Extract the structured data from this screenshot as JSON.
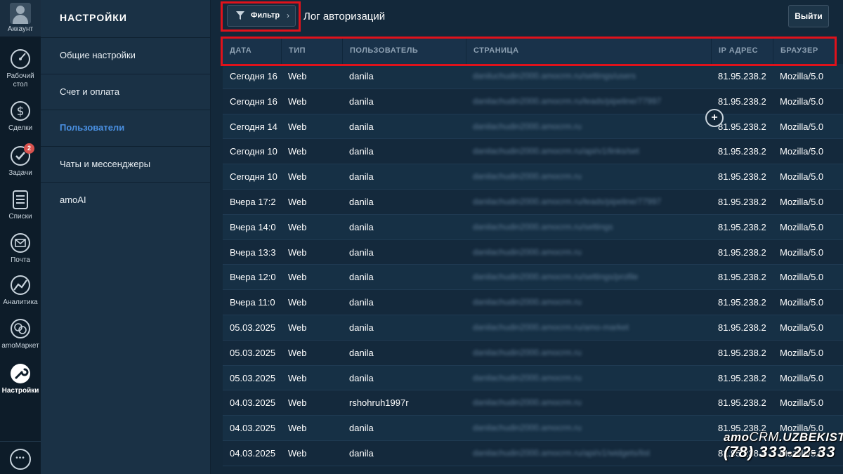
{
  "rail": {
    "account": "Аккаунт",
    "items": [
      {
        "label": "Рабочий стол",
        "icon": "dashboard-icon"
      },
      {
        "label": "Сделки",
        "icon": "dollar-icon"
      },
      {
        "label": "Задачи",
        "icon": "check-icon",
        "badge": "2"
      },
      {
        "label": "Списки",
        "icon": "list-icon"
      },
      {
        "label": "Почта",
        "icon": "mail-icon"
      },
      {
        "label": "Аналитика",
        "icon": "analytics-icon"
      },
      {
        "label": "amoМаркет",
        "icon": "market-icon"
      },
      {
        "label": "Настройки",
        "icon": "settings-icon"
      }
    ]
  },
  "sidebar": {
    "title": "НАСТРОЙКИ",
    "items": [
      {
        "label": "Общие настройки"
      },
      {
        "label": "Счет и оплата"
      },
      {
        "label": "Пользователи"
      },
      {
        "label": "Чаты и мессенджеры"
      },
      {
        "label": "amoAI"
      }
    ]
  },
  "toolbar": {
    "filter_label": "Фильтр",
    "filter_chevron": "›",
    "page_title": "Лог авторизаций",
    "logout_label": "Выйти"
  },
  "table": {
    "headers": [
      "ДАТА",
      "ТИП",
      "ПОЛЬЗОВАТЕЛЬ",
      "СТРАНИЦА",
      "IP АДРЕС",
      "БРАУЗЕР"
    ],
    "rows": [
      {
        "date": "Сегодня 16",
        "type": "Web",
        "user": "danila",
        "page": "daniluchudin2000.amocrm.ru/settings/users",
        "ip": "81.95.238.2",
        "browser": "Mozilla/5.0"
      },
      {
        "date": "Сегодня 16",
        "type": "Web",
        "user": "danila",
        "page": "danilachudin2000.amocrm.ru/leads/pipeline/77997",
        "ip": "81.95.238.2",
        "browser": "Mozilla/5.0"
      },
      {
        "date": "Сегодня 14",
        "type": "Web",
        "user": "danila",
        "page": "danilachudin2000.amocrm.ru",
        "ip": "81.95.238.2",
        "browser": "Mozilla/5.0"
      },
      {
        "date": "Сегодня 10",
        "type": "Web",
        "user": "danila",
        "page": "danilachudin2000.amocrm.ru/api/v1/links/set",
        "ip": "81.95.238.2",
        "browser": "Mozilla/5.0"
      },
      {
        "date": "Сегодня 10",
        "type": "Web",
        "user": "danila",
        "page": "danilachudin2000.amocrm.ru",
        "ip": "81.95.238.2",
        "browser": "Mozilla/5.0"
      },
      {
        "date": "Вчера 17:2",
        "type": "Web",
        "user": "danila",
        "page": "danilachudin2000.amocrm.ru/leads/pipeline/77997",
        "ip": "81.95.238.2",
        "browser": "Mozilla/5.0"
      },
      {
        "date": "Вчера 14:0",
        "type": "Web",
        "user": "danila",
        "page": "danilachudin2000.amocrm.ru/settings",
        "ip": "81.95.238.2",
        "browser": "Mozilla/5.0"
      },
      {
        "date": "Вчера 13:3",
        "type": "Web",
        "user": "danila",
        "page": "danilachudin2000.amocrm.ru",
        "ip": "81.95.238.2",
        "browser": "Mozilla/5.0"
      },
      {
        "date": "Вчера 12:0",
        "type": "Web",
        "user": "danila",
        "page": "danilachudin2000.amocrm.ru/settings/profile",
        "ip": "81.95.238.2",
        "browser": "Mozilla/5.0"
      },
      {
        "date": "Вчера 11:0",
        "type": "Web",
        "user": "danila",
        "page": "danilachudin2000.amocrm.ru",
        "ip": "81.95.238.2",
        "browser": "Mozilla/5.0"
      },
      {
        "date": "05.03.2025",
        "type": "Web",
        "user": "danila",
        "page": "danilachudin2000.amocrm.ru/amo-market",
        "ip": "81.95.238.2",
        "browser": "Mozilla/5.0"
      },
      {
        "date": "05.03.2025",
        "type": "Web",
        "user": "danila",
        "page": "danilachudin2000.amocrm.ru",
        "ip": "81.95.238.2",
        "browser": "Mozilla/5.0"
      },
      {
        "date": "05.03.2025",
        "type": "Web",
        "user": "danila",
        "page": "danilachudin2000.amocrm.ru",
        "ip": "81.95.238.2",
        "browser": "Mozilla/5.0"
      },
      {
        "date": "04.03.2025",
        "type": "Web",
        "user": "rshohruh1997r",
        "page": "danilachudin2000.amocrm.ru",
        "ip": "81.95.238.2",
        "browser": "Mozilla/5.0"
      },
      {
        "date": "04.03.2025",
        "type": "Web",
        "user": "danila",
        "page": "danilachudin2000.amocrm.ru",
        "ip": "81.95.238.2",
        "browser": "Mozilla/5.0"
      },
      {
        "date": "04.03.2025",
        "type": "Web",
        "user": "danila",
        "page": "danilachudin2000.amocrm.ru/api/v1/widgets/list",
        "ip": "81.95.238.2",
        "browser": "Mozilla/5.0"
      }
    ]
  },
  "watermark": {
    "brand_prefix": "amo",
    "brand_crm": "CRM",
    "brand_suffix": ".UZBEKISTAN",
    "phone": "(78) 333-22-33"
  },
  "colors": {
    "accent": "#4a90e2",
    "highlight": "#e0121b",
    "badge": "#d9534f"
  }
}
